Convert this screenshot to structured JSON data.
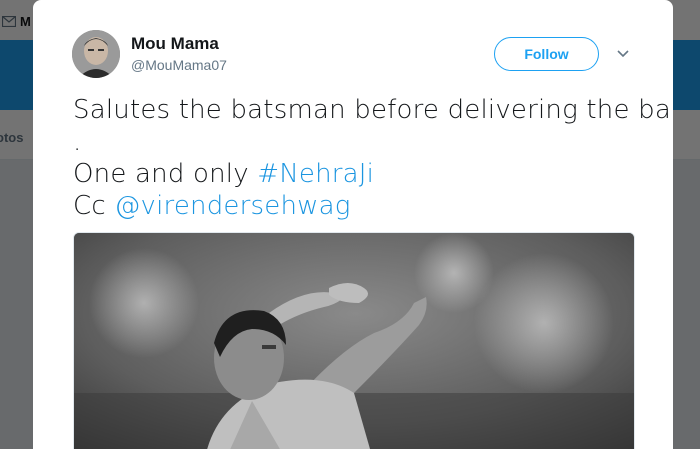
{
  "background": {
    "nav_partial_label": "M",
    "tab_partial_label": "otos"
  },
  "tweet": {
    "author_name": "Mou Mama",
    "author_handle": "@MouMama07",
    "follow_label": "Follow",
    "text_line1": "Salutes the batsman before delivering the ball",
    "text_line2": ".",
    "text_line3_prefix": "One and only ",
    "hashtag": "#NehraJi",
    "text_line4_prefix": "Cc ",
    "mention": "@virendersehwag"
  },
  "icons": {
    "mail": "mail-icon",
    "caret": "chevron-down-icon"
  },
  "colors": {
    "brand_blue": "#1da1f2",
    "link_blue": "#1b95e0",
    "text_dark": "#14171a",
    "text_muted": "#657786"
  }
}
